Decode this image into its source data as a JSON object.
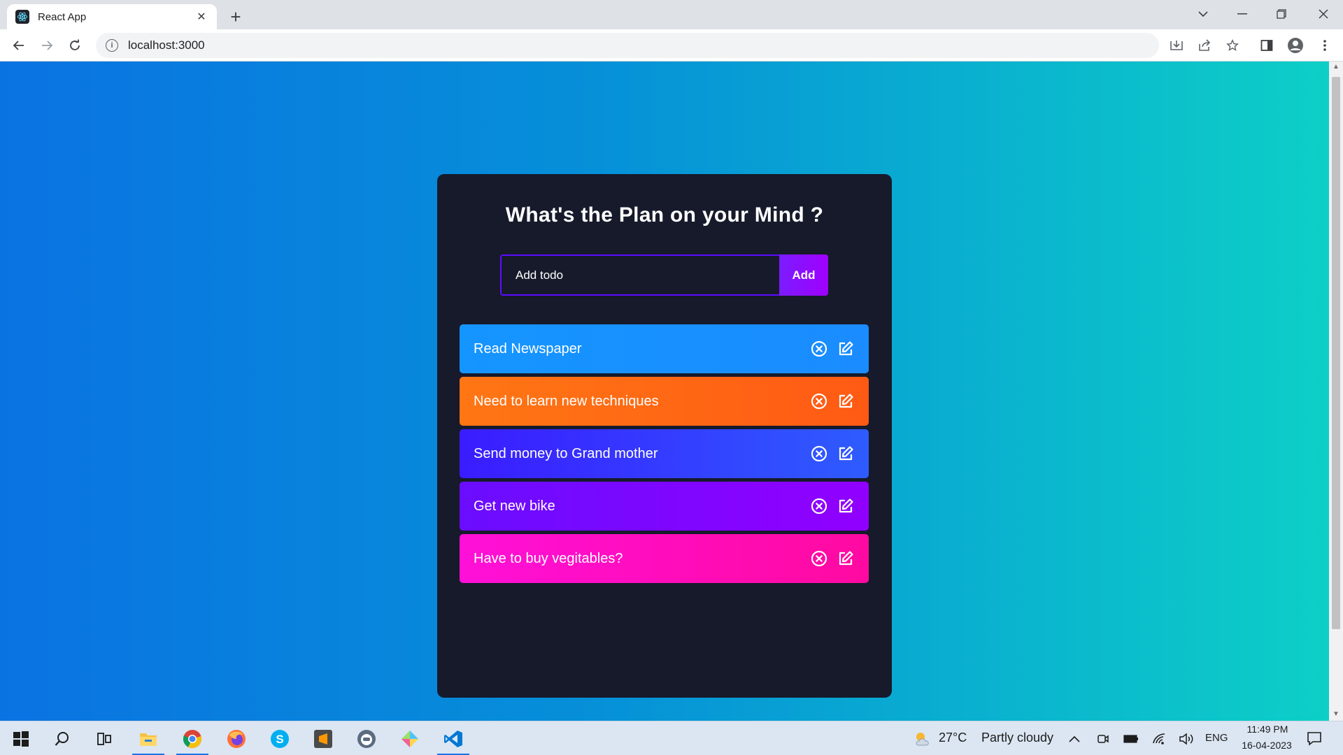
{
  "browser": {
    "tab_title": "React App",
    "url": "localhost:3000"
  },
  "app": {
    "title": "What's the Plan on your Mind ?",
    "input_placeholder": "Add todo",
    "add_button": "Add",
    "todos": [
      {
        "text": "Read Newspaper",
        "color_from": "#1595ff",
        "color_to": "#1a8cff"
      },
      {
        "text": "Need to learn new techniques",
        "color_from": "#ff7614",
        "color_to": "#ff5a14"
      },
      {
        "text": "Send money to Grand mother",
        "color_from": "#3a1cff",
        "color_to": "#2e5cff"
      },
      {
        "text": "Get new bike",
        "color_from": "#6a0dff",
        "color_to": "#9100ff"
      },
      {
        "text": "Have to buy vegitables?",
        "color_from": "#ff10d8",
        "color_to": "#ff0aa0"
      }
    ]
  },
  "taskbar": {
    "weather_temp": "27°C",
    "weather_desc": "Partly cloudy",
    "language": "ENG",
    "time": "11:49 PM",
    "date": "16-04-2023"
  }
}
